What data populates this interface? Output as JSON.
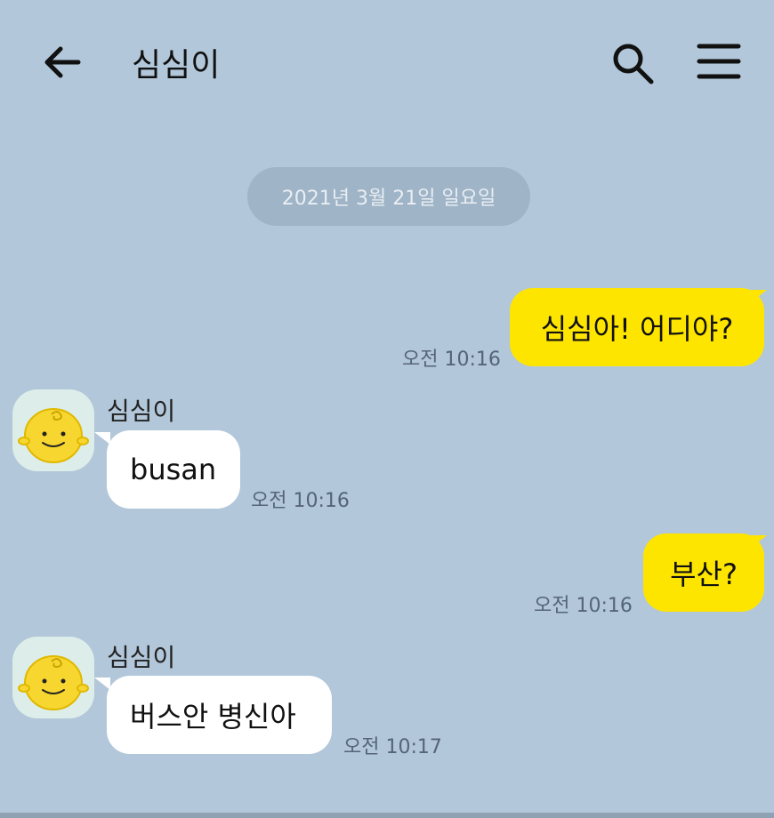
{
  "header": {
    "title": "심심이",
    "back_icon": "arrow-left-icon",
    "search_icon": "search-icon",
    "menu_icon": "hamburger-menu-icon"
  },
  "date_divider": "2021년 3월 21일 일요일",
  "colors": {
    "background": "#b2c7d9",
    "my_bubble": "#fee500",
    "bot_bubble": "#ffffff",
    "date_pill": "#9fb4c7",
    "avatar_face": "#f7d62f"
  },
  "messages": [
    {
      "from": "me",
      "text": "심심아! 어디야?",
      "time": "오전 10:16"
    },
    {
      "from": "bot",
      "sender": "심심이",
      "text": "busan",
      "time": "오전 10:16"
    },
    {
      "from": "me",
      "text": "부산?",
      "time": "오전 10:16"
    },
    {
      "from": "bot",
      "sender": "심심이",
      "text": "버스안 병신아",
      "time": "오전 10:17"
    }
  ]
}
